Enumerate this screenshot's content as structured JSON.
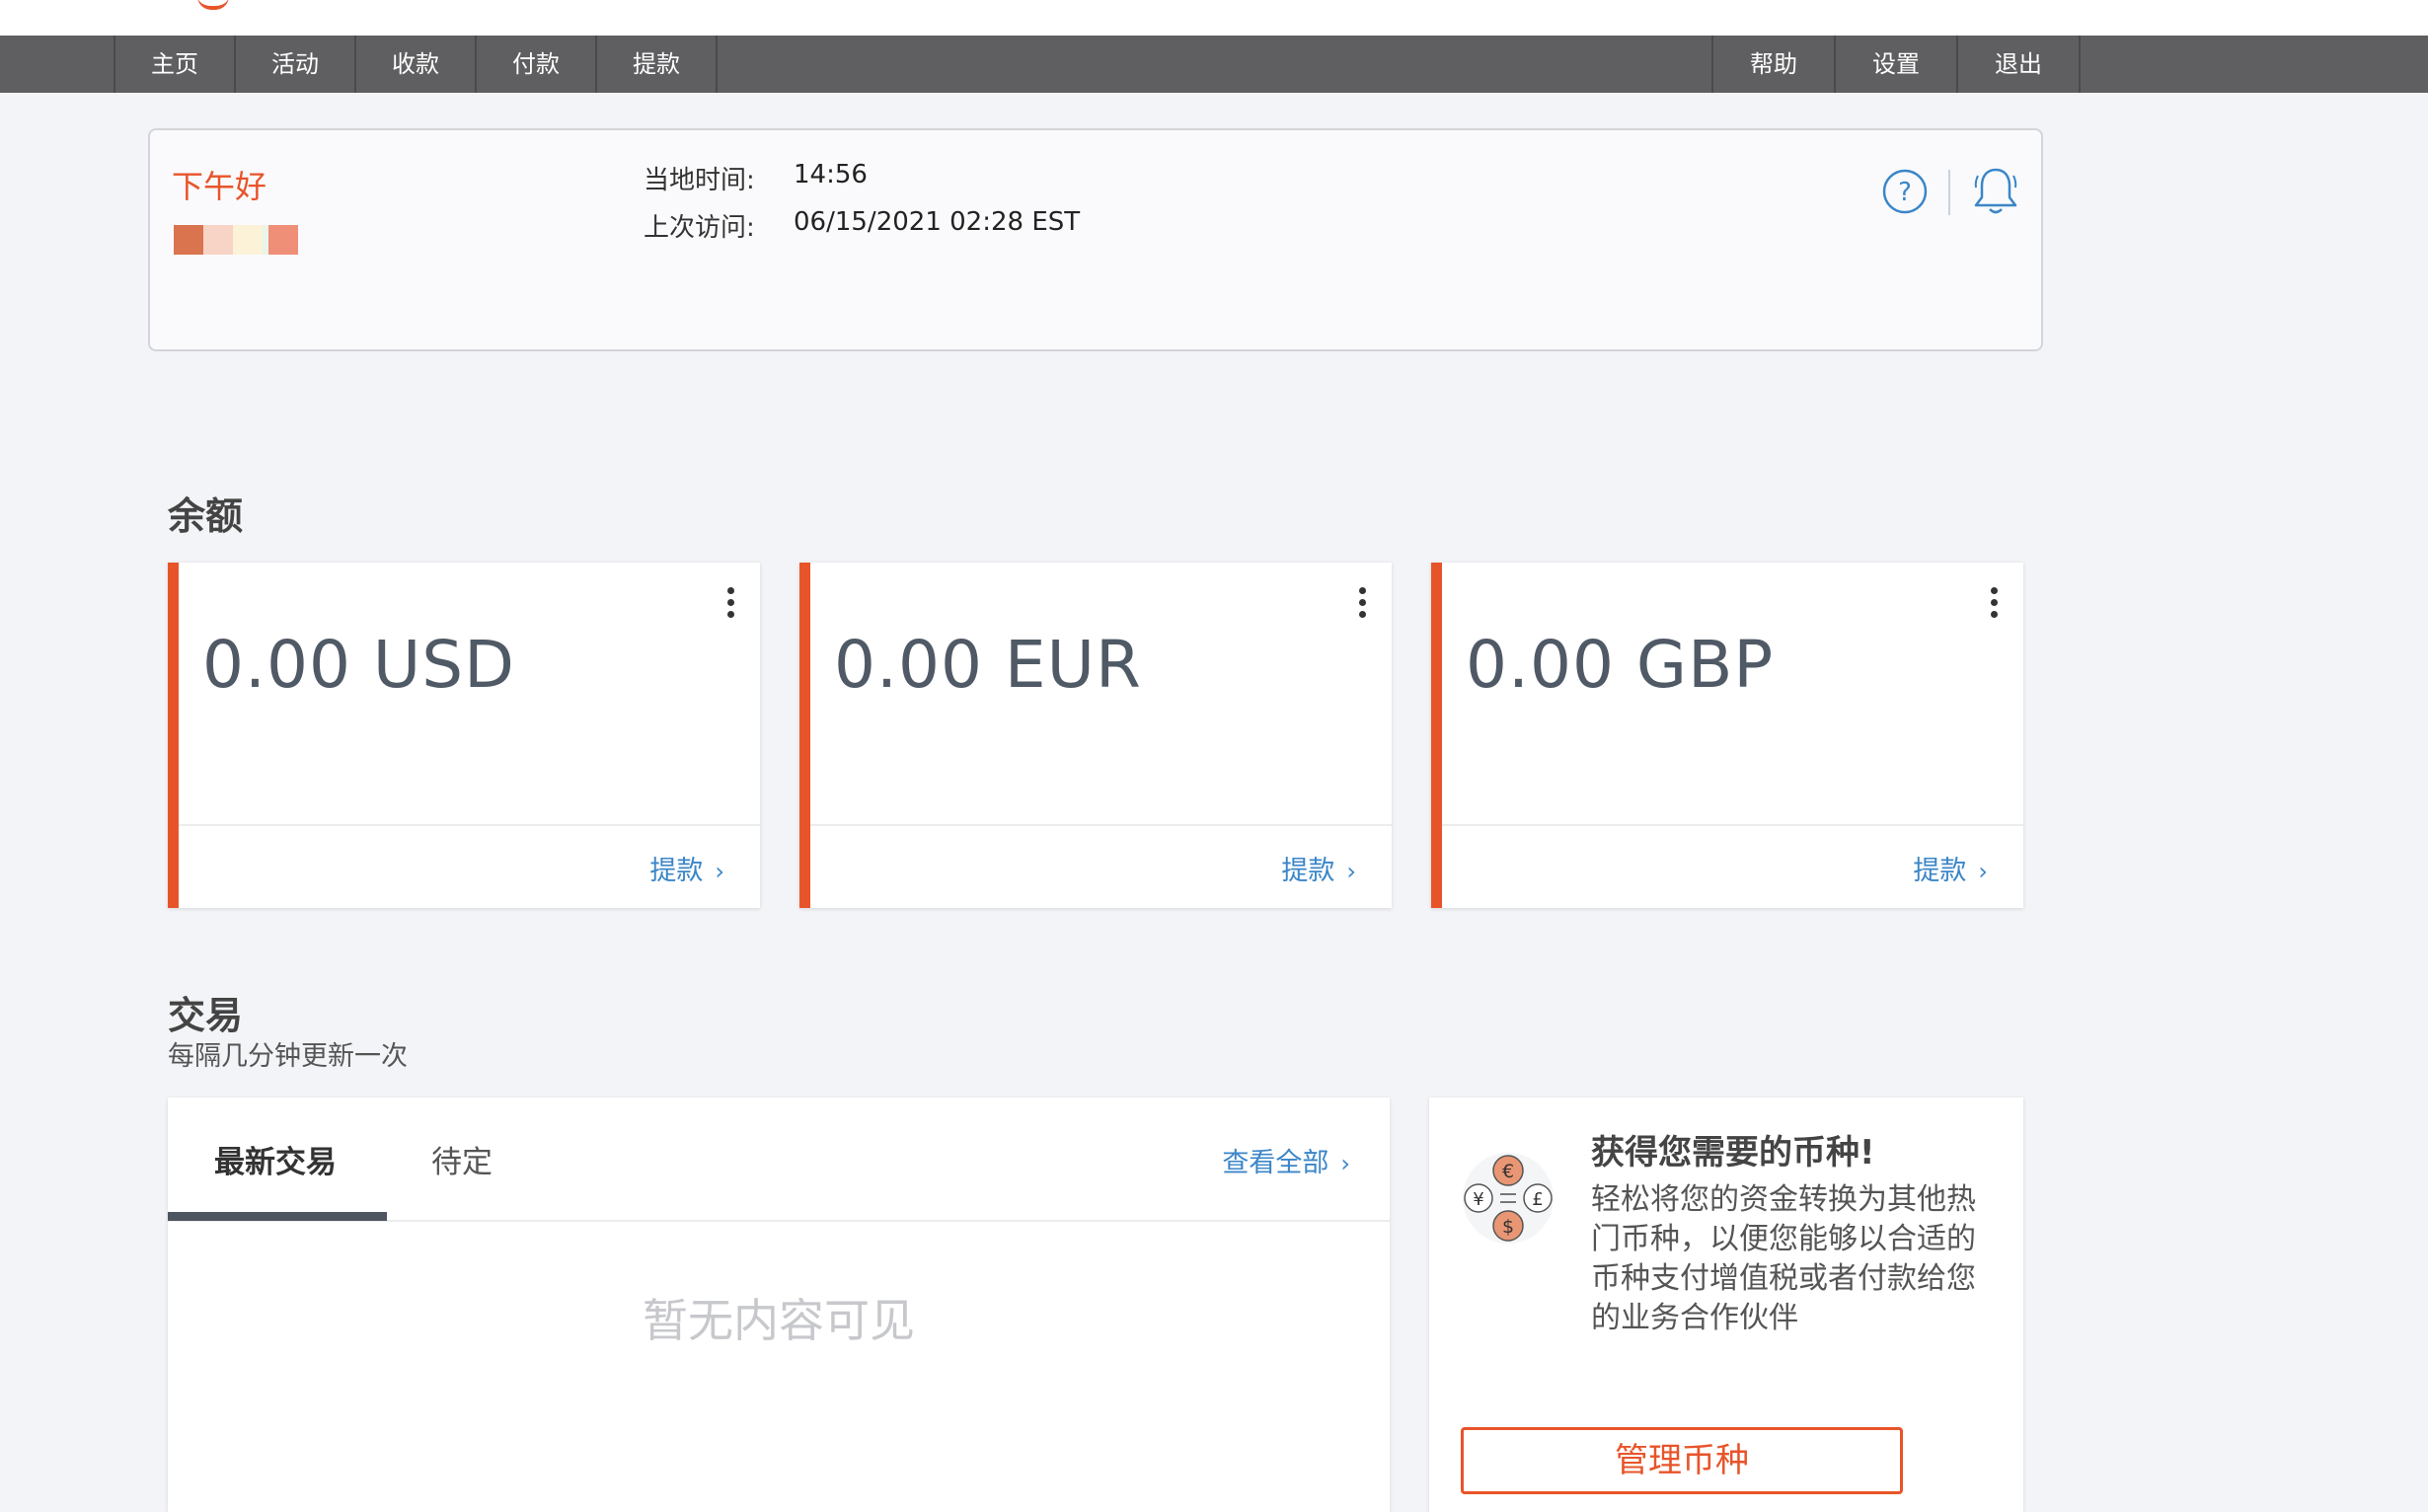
{
  "nav": {
    "left": [
      "主页",
      "活动",
      "收款",
      "付款",
      "提款"
    ],
    "right": [
      "帮助",
      "设置",
      "退出"
    ]
  },
  "header": {
    "greeting": "下午好",
    "local_time_label": "当地时间:",
    "local_time_value": "14:56",
    "last_visit_label": "上次访问:",
    "last_visit_value": "06/15/2021 02:28 EST",
    "icons": [
      "help-circle-icon",
      "bell-icon"
    ]
  },
  "balances": {
    "title": "余额",
    "cards": [
      {
        "amount": "0.00 USD",
        "action": "提款"
      },
      {
        "amount": "0.00 EUR",
        "action": "提款"
      },
      {
        "amount": "0.00 GBP",
        "action": "提款"
      }
    ]
  },
  "transactions": {
    "title": "交易",
    "subtitle": "每隔几分钟更新一次",
    "tabs": [
      "最新交易",
      "待定"
    ],
    "view_all": "查看全部",
    "empty": "暂无内容可见"
  },
  "promo": {
    "title": "获得您需要的币种!",
    "text": "轻松将您的资金转换为其他热门币种，以便您能够以合适的币种支付增值税或者付款给您的业务合作伙伴",
    "button": "管理币种",
    "icon": "currency-exchange-icon"
  },
  "colors": {
    "accent": "#e8542a",
    "link": "#3b86c8",
    "nav_bg": "#5f5f61"
  }
}
